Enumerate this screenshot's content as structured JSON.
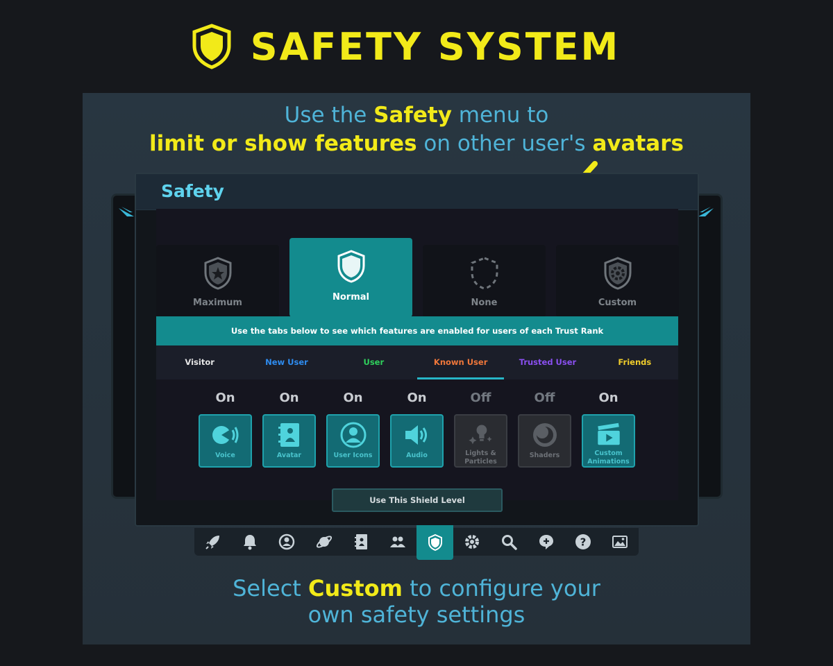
{
  "header": {
    "icon": "shield-icon",
    "title": "SAFETY SYSTEM",
    "color": "#f2ea19"
  },
  "top_caption": {
    "line1_pre": "Use the ",
    "line1_bold": "Safety",
    "line1_post": " menu to",
    "line2_bold1": "limit or show features",
    "line2_mid": " on other user's ",
    "line2_bold2": "avatars"
  },
  "window": {
    "title": "Safety"
  },
  "shield_levels": [
    {
      "label": "Maximum",
      "icon": "shield-star-icon",
      "active": false
    },
    {
      "label": "Normal",
      "icon": "shield-icon",
      "active": true
    },
    {
      "label": "None",
      "icon": "shield-dashed-icon",
      "active": false
    },
    {
      "label": "Custom",
      "icon": "shield-gear-icon",
      "active": false
    }
  ],
  "info_bar": "Use the tabs below to see which features are enabled for users of each Trust Rank",
  "trust_tabs": [
    {
      "label": "Visitor",
      "color": "#e6e6e6",
      "active": false
    },
    {
      "label": "New User",
      "color": "#2e8cf0",
      "active": false
    },
    {
      "label": "User",
      "color": "#2fd05c",
      "active": false
    },
    {
      "label": "Known User",
      "color": "#f0773a",
      "active": true
    },
    {
      "label": "Trusted User",
      "color": "#8a4ff0",
      "active": false
    },
    {
      "label": "Friends",
      "color": "#f0cd2b",
      "active": false
    }
  ],
  "features": [
    {
      "state": "On",
      "label": "Voice",
      "icon": "voice-icon"
    },
    {
      "state": "On",
      "label": "Avatar",
      "icon": "avatar-book-icon"
    },
    {
      "state": "On",
      "label": "User Icons",
      "icon": "user-icon"
    },
    {
      "state": "On",
      "label": "Audio",
      "icon": "speaker-icon"
    },
    {
      "state": "Off",
      "label": "Lights & Particles",
      "icon": "lightbulb-icon"
    },
    {
      "state": "Off",
      "label": "Shaders",
      "icon": "shader-icon"
    },
    {
      "state": "On",
      "label": "Custom Animations",
      "icon": "clapperboard-icon"
    }
  ],
  "use_button": "Use This Shield Level",
  "dock": [
    {
      "icon": "rocket-icon",
      "active": false
    },
    {
      "icon": "bell-icon",
      "active": false
    },
    {
      "icon": "profile-icon",
      "active": false
    },
    {
      "icon": "planet-icon",
      "active": false
    },
    {
      "icon": "avatar-book-icon",
      "active": false
    },
    {
      "icon": "group-icon",
      "active": false
    },
    {
      "icon": "shield-icon",
      "active": true
    },
    {
      "icon": "gear-icon",
      "active": false
    },
    {
      "icon": "search-icon",
      "active": false
    },
    {
      "icon": "chat-add-icon",
      "active": false
    },
    {
      "icon": "help-icon",
      "active": false
    },
    {
      "icon": "gallery-icon",
      "active": false
    }
  ],
  "bottom_caption": {
    "line1_pre": "Select ",
    "line1_bold": "Custom",
    "line1_post": " to configure your",
    "line2": "own safety settings"
  },
  "colors": {
    "accent": "#138b8e",
    "caption": "#4fb4d8",
    "title": "#5fd3ee"
  }
}
